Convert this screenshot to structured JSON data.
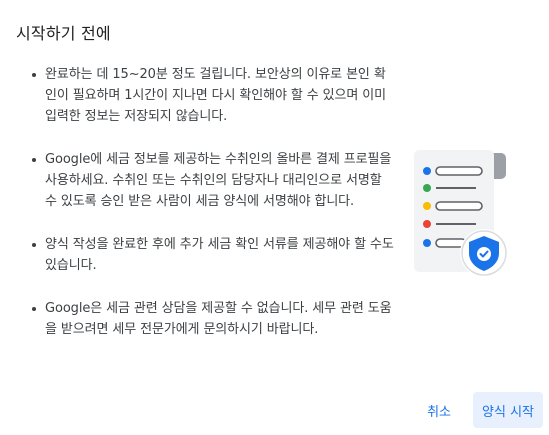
{
  "dialog": {
    "title": "시작하기 전에",
    "bullets": [
      "완료하는 데 15~20분 정도 걸립니다. 보안상의 이유로 본인 확인이 필요하며 1시간이 지나면 다시 확인해야 할 수 있으며 이미 입력한 정보는 저장되지 않습니다.",
      "Google에 세금 정보를 제공하는 수취인의 올바른 결제 프로필을 사용하세요. 수취인 또는 수취인의 담당자나 대리인으로 서명할 수 있도록 승인 받은 사람이 세금 양식에 서명해야 합니다.",
      "양식 작성을 완료한 후에 추가 세금 확인 서류를 제공해야 할 수도 있습니다.",
      "Google은 세금 관련 상담을 제공할 수 없습니다. 세무 관련 도움을 받으려면 세무 전문가에게 문의하시기 바랍니다."
    ],
    "illustration_icon": "document-checklist-shield-icon",
    "actions": {
      "cancel_label": "취소",
      "start_label": "양식 시작"
    }
  },
  "colors": {
    "accent": "#1a73e8",
    "primary_button_bg": "#e8f0fe",
    "dot_blue": "#1a73e8",
    "dot_green": "#34a853",
    "dot_yellow": "#fbbc04",
    "dot_red": "#ea4335"
  }
}
